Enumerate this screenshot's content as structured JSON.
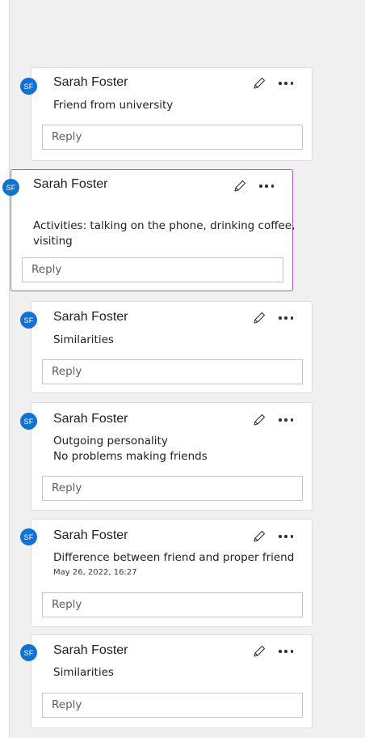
{
  "comments": [
    {
      "initials": "SF",
      "author": "Sarah Foster",
      "lines": [
        "Friend from university"
      ],
      "timestamp": "",
      "reply_placeholder": "Reply",
      "edit_icon": "pencil-icon",
      "more_icon": "ellipsis-icon"
    },
    {
      "initials": "SF",
      "author": "Sarah Foster",
      "lines": [
        "Activities: talking on the phone, drinking coffee,",
        "visiting"
      ],
      "timestamp": "",
      "reply_placeholder": "Reply",
      "edit_icon": "pencil-icon",
      "more_icon": "ellipsis-icon"
    },
    {
      "initials": "SF",
      "author": "Sarah Foster",
      "lines": [
        "Similarities"
      ],
      "timestamp": "",
      "reply_placeholder": "Reply",
      "edit_icon": "pencil-icon",
      "more_icon": "ellipsis-icon"
    },
    {
      "initials": "SF",
      "author": "Sarah Foster",
      "lines": [
        "Outgoing personality",
        "No problems making friends"
      ],
      "timestamp": "",
      "reply_placeholder": "Reply",
      "edit_icon": "pencil-icon",
      "more_icon": "ellipsis-icon"
    },
    {
      "initials": "SF",
      "author": "Sarah Foster",
      "lines": [
        "Difference between friend and proper friend"
      ],
      "timestamp": "May 26, 2022, 16:27",
      "reply_placeholder": "Reply",
      "edit_icon": "pencil-icon",
      "more_icon": "ellipsis-icon"
    },
    {
      "initials": "SF",
      "author": "Sarah Foster",
      "lines": [
        "Similarities"
      ],
      "timestamp": "",
      "reply_placeholder": "Reply",
      "edit_icon": "pencil-icon",
      "more_icon": "ellipsis-icon"
    }
  ],
  "colors": {
    "avatar": "#1172d6",
    "active_border": "#b65ab8",
    "pane_bg": "#f0f0f0"
  }
}
